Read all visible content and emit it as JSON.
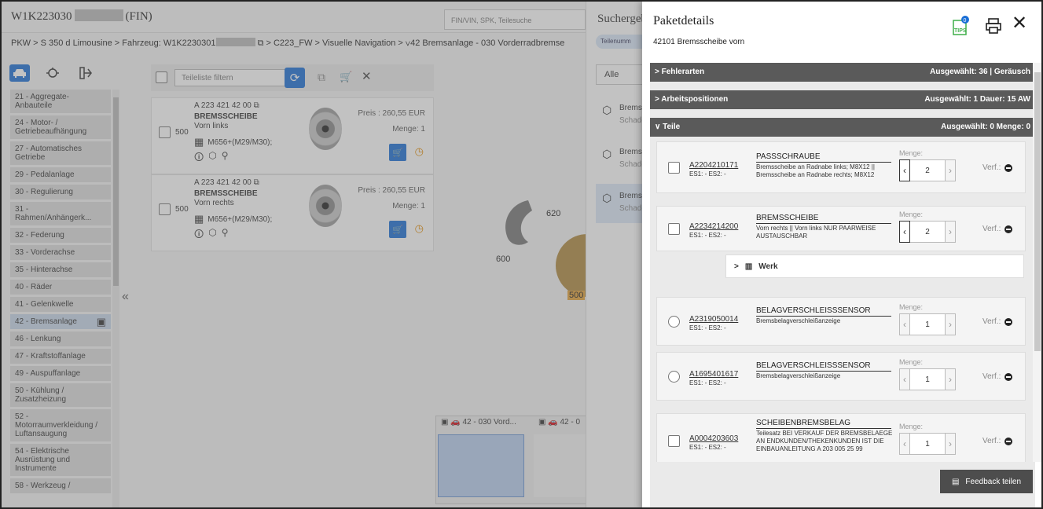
{
  "header": {
    "vin_prefix": "W1K223030",
    "vin_suffix": "(FIN)",
    "search_placeholder": "FIN/VIN, SPK, Teilesuche"
  },
  "breadcrumb": {
    "part1": "PKW > S 350 d Limousine > Fahrzeug: W1K2230301",
    "part2": "> C223_FW > Visuelle Navigation >",
    "part3": "42 Bremsanlage - 030 Vorderradbremse"
  },
  "nav": {
    "items": [
      "21 - Aggregate-Anbauteile",
      "24 - Motor- / Getriebeaufhängung",
      "27 - Automatisches Getriebe",
      "29 - Pedalanlage",
      "30 - Regulierung",
      "31 - Rahmen/Anhängerk...",
      "32 - Federung",
      "33 - Vorderachse",
      "35 - Hinterachse",
      "40 - Räder",
      "41 - Gelenkwelle",
      "42 - Bremsanlage",
      "46 - Lenkung",
      "47 - Kraftstoffanlage",
      "49 - Auspuffanlage",
      "50 - Kühlung / Zusatzheizung",
      "52 - Motorraumverkleidung / Luftansaugung",
      "54 - Elektrische Ausrüstung und Instrumente",
      "58 - Werkzeug /"
    ],
    "selected_index": 11,
    "collapse_label": "«"
  },
  "list": {
    "filter_placeholder": "Teileliste filtern",
    "parts": [
      {
        "number": "A 223 421 42 00",
        "name": "BREMSSCHEIBE",
        "desc": "Vorn links",
        "qty": "500",
        "motor": "M656+(M29/M30);",
        "price": "Preis : 260,55 EUR",
        "menge": "Menge: 1"
      },
      {
        "number": "A 223 421 42 00",
        "name": "BREMSSCHEIBE",
        "desc": "Vorn rechts",
        "qty": "500",
        "motor": "M656+(M29/M30);",
        "price": "Preis : 260,55 EUR",
        "menge": "Menge: 1"
      }
    ]
  },
  "diagram": {
    "label600": "600",
    "label620": "620",
    "label500": "500",
    "thumb1": "42 - 030 Vord...",
    "thumb2": "42 - 0"
  },
  "search_results": {
    "title": "Suchergeb",
    "chip": "Teilenumm",
    "tab_all": "Alle",
    "items": [
      {
        "title": "Bremss",
        "sub": "Schade"
      },
      {
        "title": "Bremss",
        "sub": "Schade"
      },
      {
        "title": "Bremss",
        "sub": "Schade"
      }
    ]
  },
  "panel": {
    "title": "Paketdetails",
    "subtitle": "42101 Bremsscheibe vorn",
    "tips_label": "TIPS",
    "tips_count": "0",
    "sections": [
      {
        "label": "Fehlerarten",
        "right": "Ausgewählt: 36  |  Geräusch",
        "arrow": ">"
      },
      {
        "label": "Arbeitspositionen",
        "right": "Ausgewählt: 1     Dauer: 15 AW",
        "arrow": ">"
      },
      {
        "label": "Teile",
        "right": "Ausgewählt: 0     Menge: 0",
        "arrow": "∨"
      }
    ],
    "menge_label": "Menge:",
    "verf_label": "Verf.:",
    "werk_label": "Werk",
    "werk_arrow": ">",
    "parts": [
      {
        "number": "A2204210171",
        "es": "ES1: - ES2: -",
        "name": "PASSSCHRAUBE",
        "desc": "Bremsscheibe an Radnabe links; M8X12 || Bremsscheibe an Radnabe rechts; M8X12",
        "qty": "2"
      },
      {
        "number": "A2234214200",
        "es": "ES1: - ES2: -",
        "name": "BREMSSCHEIBE",
        "desc": "Vorn rechts || Vorn links NUR PAARWEISE AUSTAUSCHBAR",
        "qty": "2"
      },
      {
        "number": "A2319050014",
        "es": "ES1: - ES2: -",
        "name": "BELAGVERSCHLEISSSENSOR",
        "desc": "Bremsbelagverschleißanzeige",
        "qty": "1"
      },
      {
        "number": "A1695401617",
        "es": "ES1: - ES2: -",
        "name": "BELAGVERSCHLEISSSENSOR",
        "desc": "Bremsbelagverschleißanzeige",
        "qty": "1"
      },
      {
        "number": "A0004203603",
        "es": "ES1: - ES2: -",
        "name": "SCHEIBENBREMSBELAG",
        "desc": "Teilesatz BEI VERKAUF DER BREMSBELAEGE AN ENDKUNDEN/THEKENKUNDEN IST DIE EINBAUANLEITUNG A 203 005 25 99",
        "qty": "1"
      }
    ],
    "feedback_label": "Feedback teilen"
  },
  "colors": {
    "accent": "#1a6fd6",
    "section_bar": "#5a5a5a",
    "orange": "#e38b00",
    "tips_green": "#3fae49"
  }
}
